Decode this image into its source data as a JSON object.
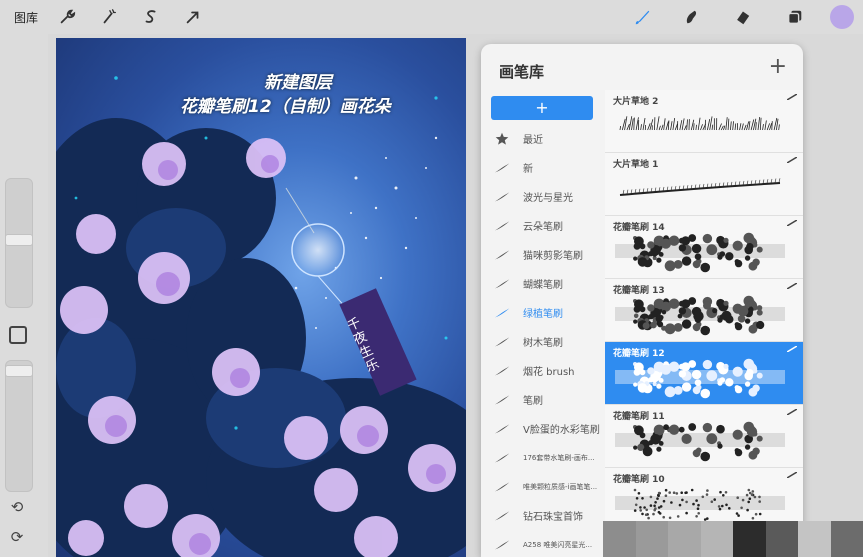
{
  "topbar": {
    "gallery_label": "图库",
    "left_icons": [
      "wrench-icon",
      "magic-wand-icon",
      "selection-icon",
      "transform-arrow-icon"
    ],
    "right_icons": [
      "brush-icon",
      "smudge-icon",
      "eraser-icon",
      "layers-icon"
    ],
    "accent": "#2f8cf0",
    "avatar_color": "#b9a6e8"
  },
  "canvas": {
    "caption_line1": "新建图层",
    "caption_line2": "花瓣笔刷12（自制）画花朵",
    "chime_text": "千夜生乐"
  },
  "brush_library": {
    "title": "画笔库",
    "add_symbol": "+",
    "categories": [
      {
        "label": "最近",
        "icon": "star-icon",
        "small": false,
        "active": false
      },
      {
        "label": "新",
        "icon": "brush-stroke-icon",
        "small": false,
        "active": false
      },
      {
        "label": "波光与星光",
        "icon": "brush-stroke-icon",
        "small": false,
        "active": false
      },
      {
        "label": "云朵笔刷",
        "icon": "brush-stroke-icon",
        "small": false,
        "active": false
      },
      {
        "label": "猫咪剪影笔刷",
        "icon": "brush-stroke-icon",
        "small": false,
        "active": false
      },
      {
        "label": "蝴蝶笔刷",
        "icon": "brush-stroke-icon",
        "small": false,
        "active": false
      },
      {
        "label": "绿植笔刷",
        "icon": "brush-stroke-icon",
        "small": false,
        "active": true
      },
      {
        "label": "树木笔刷",
        "icon": "brush-stroke-icon",
        "small": false,
        "active": false
      },
      {
        "label": "烟花 brush",
        "icon": "brush-stroke-icon",
        "small": false,
        "active": false
      },
      {
        "label": "笔刷",
        "icon": "brush-stroke-icon",
        "small": false,
        "active": false
      },
      {
        "label": "V脸蛋的水彩笔刷",
        "icon": "brush-stroke-icon",
        "small": false,
        "active": false
      },
      {
        "label": "176套带水笔刷-画布...",
        "icon": "brush-stroke-icon",
        "small": true,
        "active": false
      },
      {
        "label": "唯美颗粒质感-i画笔笔...",
        "icon": "brush-stroke-icon",
        "small": true,
        "active": false
      },
      {
        "label": "钻石珠宝首饰",
        "icon": "brush-stroke-icon",
        "small": false,
        "active": false
      },
      {
        "label": "A258 唯美闪亮星光...",
        "icon": "brush-stroke-icon",
        "small": true,
        "active": false
      }
    ],
    "brushes": [
      {
        "name": "大片草地 2",
        "selected": false,
        "style": "grass"
      },
      {
        "name": "大片草地 1",
        "selected": false,
        "style": "line"
      },
      {
        "name": "花瓣笔刷 14",
        "selected": false,
        "style": "petals"
      },
      {
        "name": "花瓣笔刷 13",
        "selected": false,
        "style": "petals-dense"
      },
      {
        "name": "花瓣笔刷 12",
        "selected": true,
        "style": "petals-light"
      },
      {
        "name": "花瓣笔刷 11",
        "selected": false,
        "style": "petals-sparse"
      },
      {
        "name": "花瓣笔刷 10",
        "selected": false,
        "style": "dots"
      }
    ]
  },
  "swatches": [
    "#8d8d8d",
    "#9a9a9a",
    "#a8a8a8",
    "#b5b5b5",
    "#2c2c2c",
    "#5a5a5a",
    "#c4c4c4",
    "#6c6c6c"
  ]
}
